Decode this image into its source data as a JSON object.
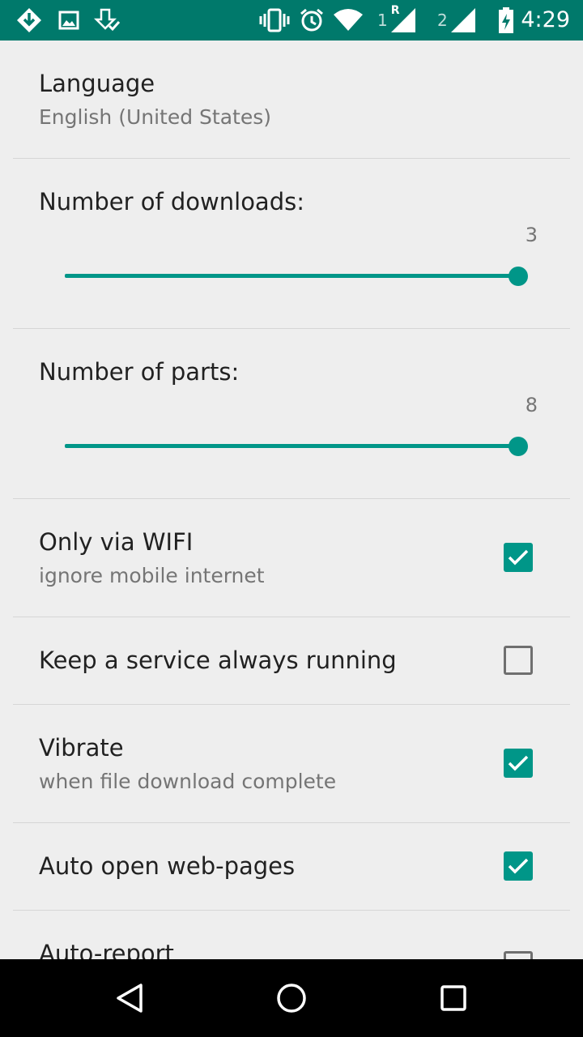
{
  "status_bar": {
    "time": "4:29",
    "left_icons": [
      "download-icon",
      "image-icon",
      "download-done-icon"
    ],
    "right_icons": [
      "vibrate-icon",
      "alarm-icon",
      "wifi-icon",
      "signal-sim1-icon",
      "signal-sim2-icon",
      "battery-icon"
    ],
    "sim1_label": "1",
    "sim1_roaming": "R",
    "sim2_label": "2",
    "background": "#00796b"
  },
  "settings": {
    "language": {
      "title": "Language",
      "summary": "English (United States)"
    },
    "downloads": {
      "title": "Number of downloads:",
      "value": "3",
      "level": 1.0
    },
    "parts": {
      "title": "Number of parts:",
      "value": "8",
      "level": 1.0
    },
    "wifi_only": {
      "title": "Only via WIFI",
      "summary": "ignore mobile internet",
      "checked": true
    },
    "keep_service": {
      "title": "Keep a service always running",
      "checked": false
    },
    "vibrate": {
      "title": "Vibrate",
      "summary": "when file download complete",
      "checked": true
    },
    "auto_open": {
      "title": "Auto open web-pages",
      "checked": true
    },
    "auto_report": {
      "title": "Auto-report",
      "checked": false
    }
  },
  "nav_bar": {
    "icons": [
      "back-icon",
      "home-icon",
      "recents-icon"
    ]
  },
  "colors": {
    "accent": "#009688",
    "status_bar": "#00796b",
    "background": "#eeeeee"
  }
}
